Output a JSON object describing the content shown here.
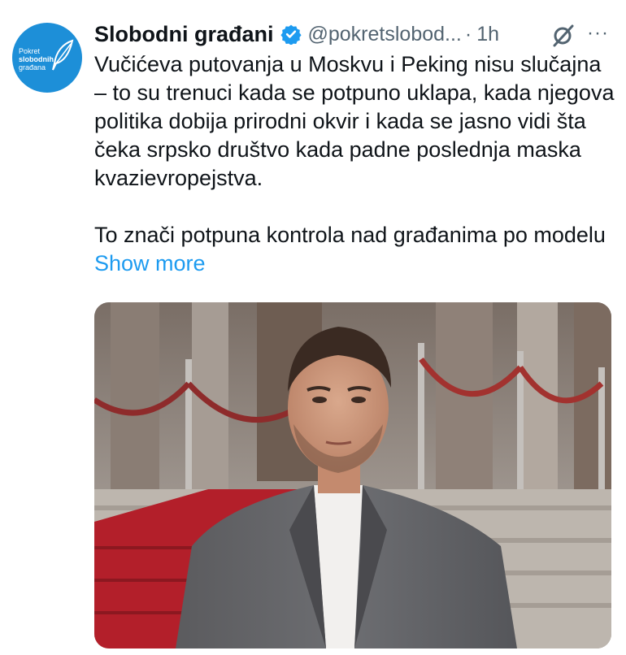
{
  "account": {
    "display_name": "Slobodni građani",
    "handle": "@pokretslobod...",
    "separator": "·",
    "time": "1h",
    "avatar_lines": [
      "Pokret",
      "slobodnih",
      "građana"
    ]
  },
  "tweet": {
    "paragraph1": "Vučićeva putovanja u Moskvu i Peking nisu slučajna – to su trenuci kada se potpuno uklapa, kada njegova politika dobija prirodni okvir i kada se jasno vidi šta čeka srpsko društvo kada padne poslednja maska kvazievropejstva.",
    "paragraph2": "To znači potpuna kontrola nad građanima po modelu",
    "show_more": "Show more"
  },
  "icons": {
    "verified": "verified-badge-icon",
    "grok": "grok-icon",
    "more": "more-options-icon",
    "avatar_feather": "feather-icon"
  },
  "colors": {
    "text": "#0f1419",
    "secondary": "#536471",
    "link": "#1d9bf0",
    "avatar_bg": "#1d8fd8"
  }
}
